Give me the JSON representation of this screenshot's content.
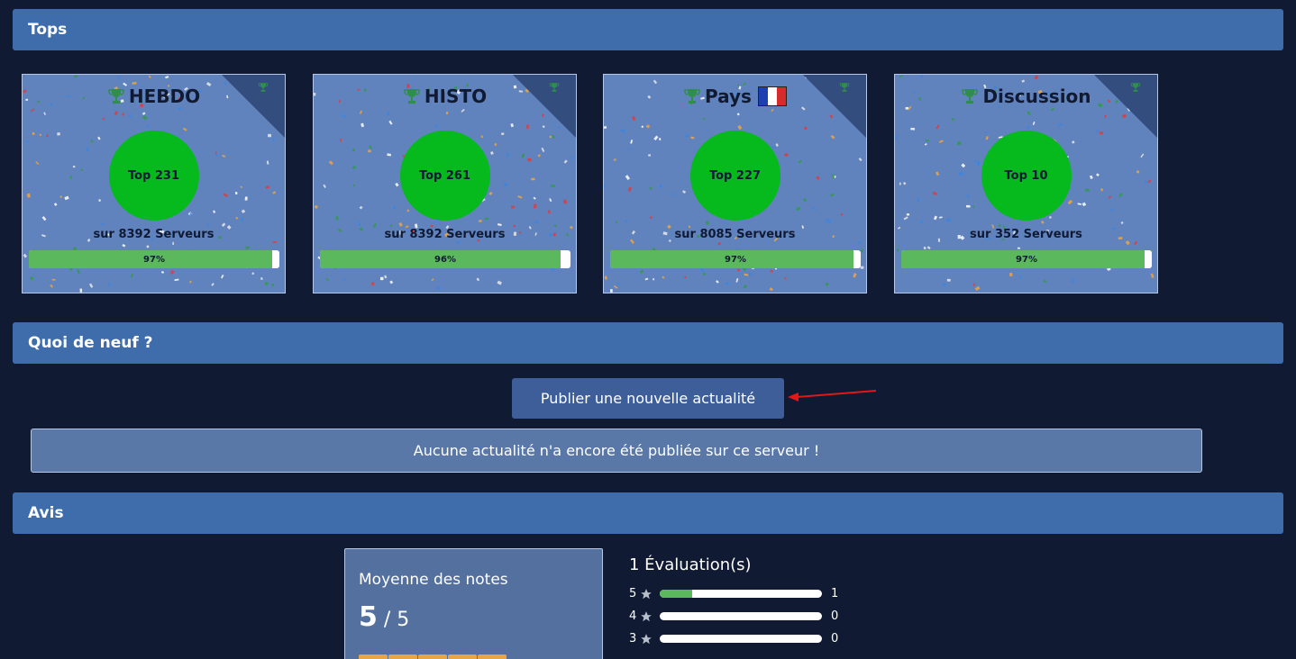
{
  "sections": {
    "tops": "Tops",
    "news": "Quoi de neuf ?",
    "reviews": "Avis"
  },
  "top_cards": [
    {
      "title": "HEBDO",
      "rank": "Top 231",
      "subtitle": "sur 8392 Serveurs",
      "percent_label": "97%",
      "percent": 97,
      "flag": false
    },
    {
      "title": "HISTO",
      "rank": "Top 261",
      "subtitle": "sur 8392 Serveurs",
      "percent_label": "96%",
      "percent": 96,
      "flag": false
    },
    {
      "title": "Pays",
      "rank": "Top 227",
      "subtitle": "sur 8085 Serveurs",
      "percent_label": "97%",
      "percent": 97,
      "flag": true
    },
    {
      "title": "Discussion",
      "rank": "Top 10",
      "subtitle": "sur 352 Serveurs",
      "percent_label": "97%",
      "percent": 97,
      "flag": false
    }
  ],
  "news": {
    "publish_label": "Publier une nouvelle actualité",
    "empty_message": "Aucune actualité n'a encore été publiée sur ce serveur !"
  },
  "reviews": {
    "average_title": "Moyenne des notes",
    "average_score": "5",
    "average_max": " / 5",
    "evaluations_title": "1 Évaluation(s)",
    "rows": [
      {
        "stars": "5",
        "count": "1",
        "fraction": 0.2
      },
      {
        "stars": "4",
        "count": "0",
        "fraction": 0
      },
      {
        "stars": "3",
        "count": "0",
        "fraction": 0
      }
    ]
  },
  "colors": {
    "background": "#101a33",
    "header": "#3f6dab",
    "card": "#6183bd",
    "rank_circle": "#06b91c",
    "progress": "#5cb85c",
    "rating_stars": "#e7a546"
  },
  "icons": {
    "trophy": "trophy-icon",
    "star": "star-icon",
    "flag": "france-flag-icon"
  }
}
